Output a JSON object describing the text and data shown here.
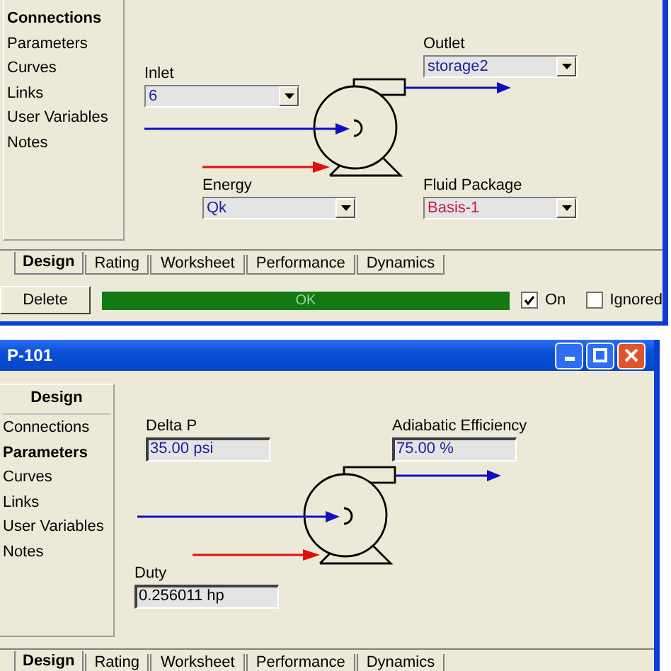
{
  "windows": [
    {
      "kind": "connections",
      "sidebar": {
        "items": [
          {
            "label": "Connections",
            "selected": true
          },
          {
            "label": "Parameters",
            "selected": false
          },
          {
            "label": "Curves",
            "selected": false
          },
          {
            "label": "Links",
            "selected": false
          },
          {
            "label": "User Variables",
            "selected": false
          },
          {
            "label": "Notes",
            "selected": false
          }
        ]
      },
      "fields": [
        {
          "kind": "combo",
          "label": "Inlet",
          "value": "6",
          "color": "#2020a0"
        },
        {
          "kind": "combo",
          "label": "Outlet",
          "value": "storage2",
          "color": "#2020a0"
        },
        {
          "kind": "combo",
          "label": "Energy",
          "value": "Qk",
          "color": "#2020a0"
        },
        {
          "kind": "combo",
          "label": "Fluid Package",
          "value": "Basis-1",
          "color": "#c02040"
        }
      ],
      "tabs": [
        {
          "label": "Design",
          "selected": true
        },
        {
          "label": "Rating",
          "selected": false
        },
        {
          "label": "Worksheet",
          "selected": false
        },
        {
          "label": "Performance",
          "selected": false
        },
        {
          "label": "Dynamics",
          "selected": false
        }
      ],
      "footer": {
        "button": "Delete",
        "status": "OK",
        "on": {
          "label": "On",
          "checked": true
        },
        "ignored": {
          "label": "Ignored",
          "checked": false
        }
      }
    },
    {
      "kind": "parameters",
      "title": "P-101",
      "sidebar": {
        "header": "Design",
        "items": [
          {
            "label": "Connections",
            "selected": false
          },
          {
            "label": "Parameters",
            "selected": true
          },
          {
            "label": "Curves",
            "selected": false
          },
          {
            "label": "Links",
            "selected": false
          },
          {
            "label": "User Variables",
            "selected": false
          },
          {
            "label": "Notes",
            "selected": false
          }
        ]
      },
      "fields": [
        {
          "kind": "text",
          "label": "Delta P",
          "value": "35.00 psi",
          "color": "#2020a0"
        },
        {
          "kind": "text",
          "label": "Adiabatic Efficiency",
          "value": "75.00 %",
          "color": "#2020a0"
        },
        {
          "kind": "text",
          "label": "Duty",
          "value": "0.256011 hp",
          "color": "#000000"
        }
      ],
      "tabs": [
        {
          "label": "Design",
          "selected": true
        },
        {
          "label": "Rating",
          "selected": false
        },
        {
          "label": "Worksheet",
          "selected": false
        },
        {
          "label": "Performance",
          "selected": false
        },
        {
          "label": "Dynamics",
          "selected": false
        }
      ]
    }
  ]
}
